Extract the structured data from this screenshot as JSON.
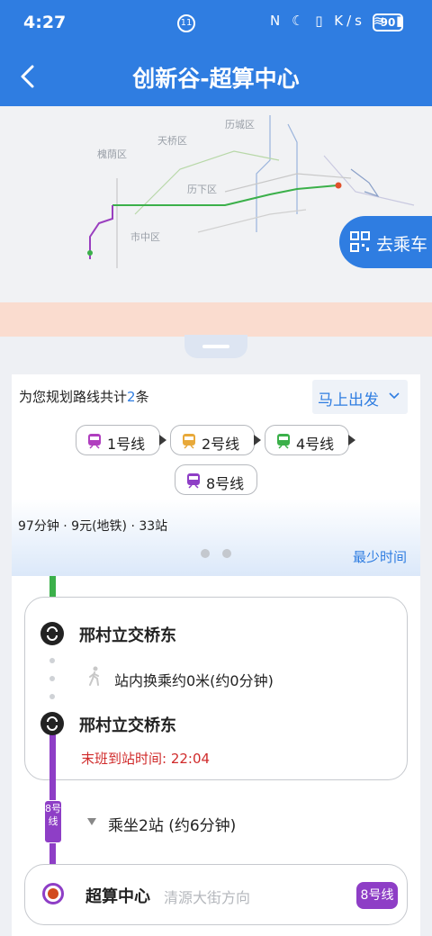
{
  "status_bar": {
    "time": "4:27",
    "badge": "11",
    "icons": "N ☾ ▯ K/s ≋ ▮",
    "battery": "90"
  },
  "header": {
    "title": "创新谷-超算中心"
  },
  "map": {
    "districts": [
      "历城区",
      "天桥区",
      "槐荫区",
      "历下区",
      "市中区"
    ],
    "go_ride_label": "去乘车"
  },
  "route_card": {
    "plan_prefix": "为您规划路线共计",
    "plan_count": "2",
    "plan_suffix": "条",
    "depart_label": "马上出发",
    "lines": [
      {
        "name": "1号线",
        "color": "#b03fbf"
      },
      {
        "name": "2号线",
        "color": "#e8a93a"
      },
      {
        "name": "4号线",
        "color": "#3bb04a"
      },
      {
        "name": "8号线",
        "color": "#8e3ec6"
      }
    ],
    "summary": "97分钟 · 9元(地铁) · 33站",
    "sort_label": "最少时间"
  },
  "detail": {
    "transfer_station_1": "邢村立交桥东",
    "walk_text": "站内换乘约0米(约0分钟)",
    "transfer_station_2": "邢村立交桥东",
    "last_train": "末班到站时间: 22:04",
    "line_tag": "8号线",
    "ride_text": "乘坐2站 (约6分钟)",
    "end_station": "超算中心",
    "end_direction": "清源大街方向",
    "end_line_badge": "8号线",
    "colors": {
      "line4": "#3bb04a",
      "line8": "#8e3ec6",
      "last_train": "#d02b2b"
    }
  }
}
